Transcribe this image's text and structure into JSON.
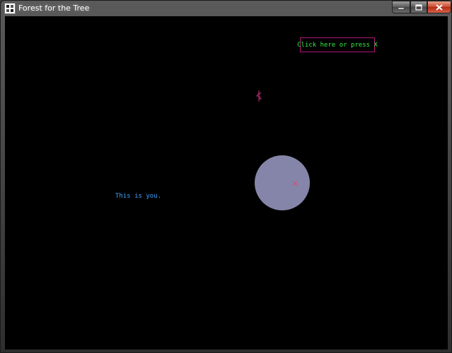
{
  "window": {
    "title": "Forest for the Tree",
    "app_icon": "window-app-icon",
    "controls": [
      "minimize-icon",
      "maximize-icon",
      "close-icon"
    ]
  },
  "game": {
    "hint_button_label": "Click here or press X",
    "player_label": "This is you.",
    "player_icon": "tree-figure-icon",
    "marker_icon": "pink-x-marker-icon"
  },
  "colors": {
    "background": "#000000",
    "hint_text": "#33ee44",
    "hint_border": "#b0147a",
    "player_label": "#3fa4ff",
    "planet": "#8585a9",
    "player": "#c0307a",
    "marker": "#e0447a"
  }
}
